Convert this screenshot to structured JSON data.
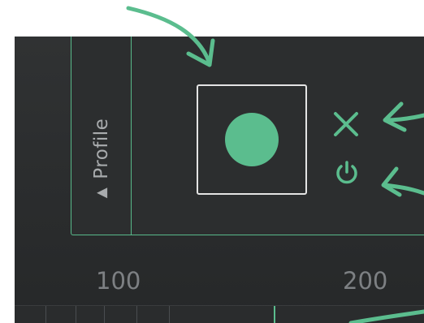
{
  "side_tab": {
    "label": "Profile",
    "arrow": "▲"
  },
  "ruler": {
    "labels": [
      "100",
      "200"
    ]
  },
  "icons": {
    "record": "record-circle-icon",
    "close": "close-icon",
    "power": "power-icon"
  },
  "colors": {
    "accent": "#5bbd8e",
    "background": "#2c2e2f",
    "text_muted": "#a8abad",
    "frame": "#e4e4e4"
  }
}
